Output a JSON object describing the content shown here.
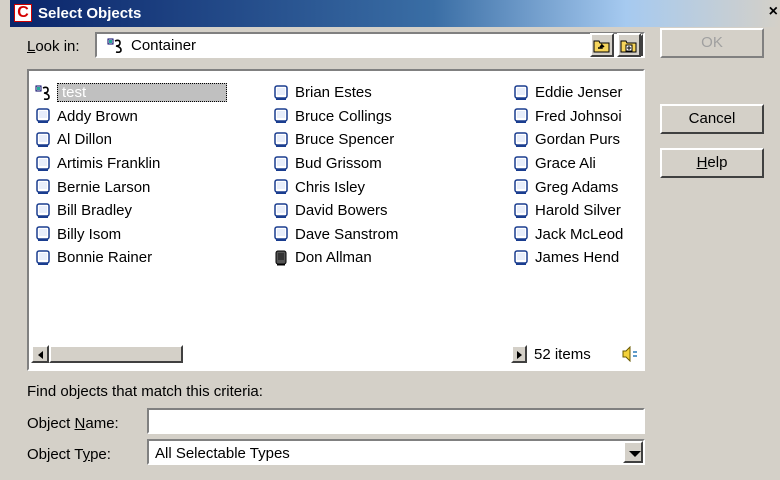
{
  "window": {
    "title": "Select Objects",
    "app_icon_letter": "C",
    "close_glyph": "×"
  },
  "look_in": {
    "label_prefix": "L",
    "label_rest": "ook in:",
    "value": "Container"
  },
  "buttons": {
    "ok": "OK",
    "cancel": "Cancel",
    "help_prefix": "H",
    "help_rest": "elp"
  },
  "list": {
    "col1": [
      {
        "label": "test",
        "icon": "container-icon",
        "selected": true
      },
      {
        "label": "Addy Brown",
        "icon": "user-icon"
      },
      {
        "label": "Al Dillon",
        "icon": "user-icon"
      },
      {
        "label": "Artimis Franklin",
        "icon": "user-icon"
      },
      {
        "label": "Bernie Larson",
        "icon": "user-icon"
      },
      {
        "label": "Bill Bradley",
        "icon": "user-icon"
      },
      {
        "label": "Billy Isom",
        "icon": "user-icon"
      },
      {
        "label": "Bonnie Rainer",
        "icon": "user-icon"
      }
    ],
    "col2": [
      {
        "label": "Brian Estes",
        "icon": "user-icon"
      },
      {
        "label": "Bruce Collings",
        "icon": "user-icon"
      },
      {
        "label": "Bruce Spencer",
        "icon": "user-icon"
      },
      {
        "label": "Bud Grissom",
        "icon": "user-icon"
      },
      {
        "label": "Chris Isley",
        "icon": "user-icon"
      },
      {
        "label": "David Bowers",
        "icon": "user-icon"
      },
      {
        "label": "Dave Sanstrom",
        "icon": "user-icon"
      },
      {
        "label": "Don Allman",
        "icon": "user-dark-icon"
      }
    ],
    "col3": [
      {
        "label": "Eddie Jenser",
        "icon": "user-icon"
      },
      {
        "label": "Fred Johnsoi",
        "icon": "user-icon"
      },
      {
        "label": "Gordan Purs",
        "icon": "user-icon"
      },
      {
        "label": "Grace Ali",
        "icon": "user-icon"
      },
      {
        "label": "Greg Adams",
        "icon": "user-icon"
      },
      {
        "label": "Harold Silver",
        "icon": "user-icon"
      },
      {
        "label": "Jack McLeod",
        "icon": "user-icon"
      },
      {
        "label": "James Hend",
        "icon": "user-icon"
      }
    ],
    "item_count": "52 items"
  },
  "criteria": {
    "heading": "Find objects that match this criteria:",
    "name_label_a": "Object ",
    "name_label_u": "N",
    "name_label_b": "ame:",
    "name_value": "",
    "type_label_a": "Object T",
    "type_label_u": "y",
    "type_label_b": "pe:",
    "type_value": "All Selectable Types"
  },
  "colors": {
    "title_start": "#0a246a",
    "dialog_bg": "#d4d0c8",
    "selection": "#c0c0c0"
  }
}
